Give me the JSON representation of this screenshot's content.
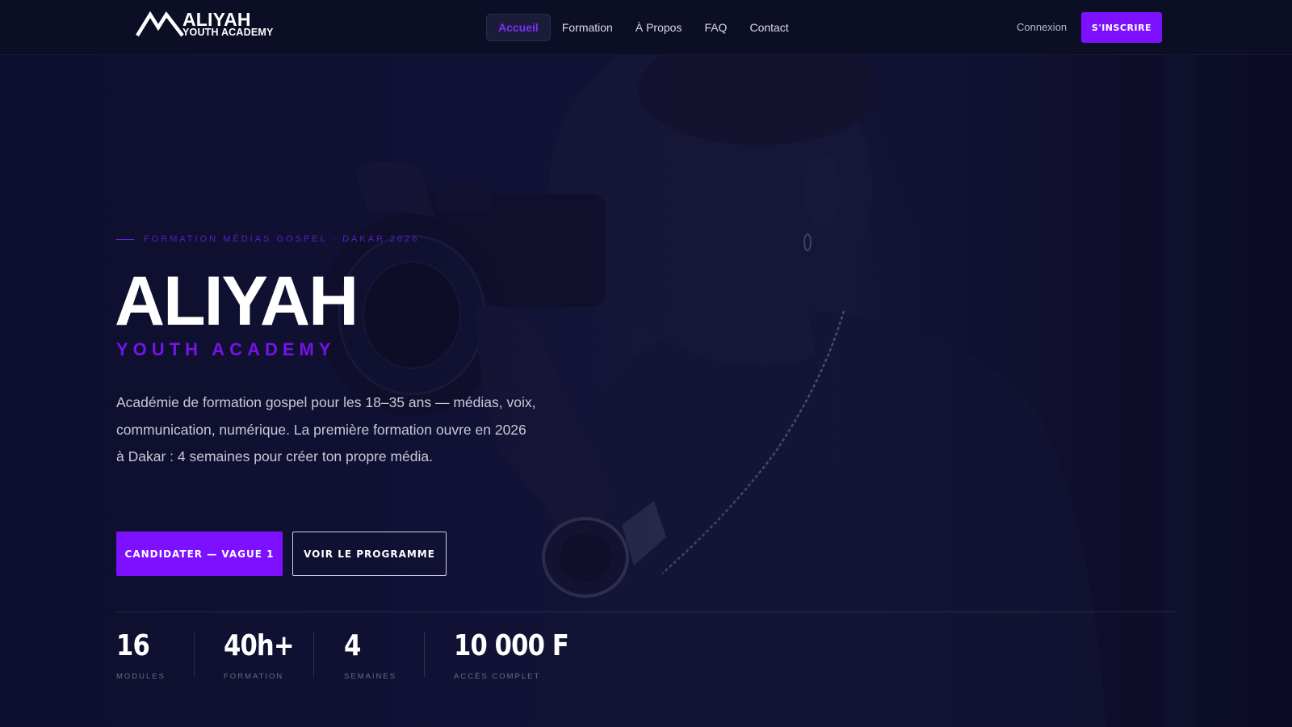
{
  "colors": {
    "accent": "#7c10ff",
    "background": "#0b0d24",
    "nav_active": "#7b2ff7"
  },
  "nav": {
    "logo": {
      "line1": "ALIYAH",
      "line2": "YOUTH ACADEMY"
    },
    "links": [
      {
        "label": "Accueil",
        "active": true
      },
      {
        "label": "Formation",
        "active": false
      },
      {
        "label": "À Propos",
        "active": false
      },
      {
        "label": "FAQ",
        "active": false
      },
      {
        "label": "Contact",
        "active": false
      }
    ],
    "login_label": "Connexion",
    "cta_label": "S'INSCRIRE"
  },
  "hero": {
    "eyebrow": "FORMATION MÉDIAS GOSPEL · DAKAR 2026",
    "title": "ALIYAH",
    "subtitle": "YOUTH ACADEMY",
    "description": "Académie de formation gospel pour les 18–35 ans — médias, voix, communication, numérique. La première formation ouvre en 2026 à Dakar : 4 semaines pour créer ton propre média.",
    "primary_button": "CANDIDATER — VAGUE 1",
    "secondary_button": "VOIR LE PROGRAMME"
  },
  "stats": [
    {
      "value": "16",
      "label": "MODULES"
    },
    {
      "value": "40h+",
      "label": "FORMATION"
    },
    {
      "value": "4",
      "label": "SEMAINES"
    },
    {
      "value": "10 000 F",
      "label": "ACCÈS COMPLET"
    }
  ]
}
